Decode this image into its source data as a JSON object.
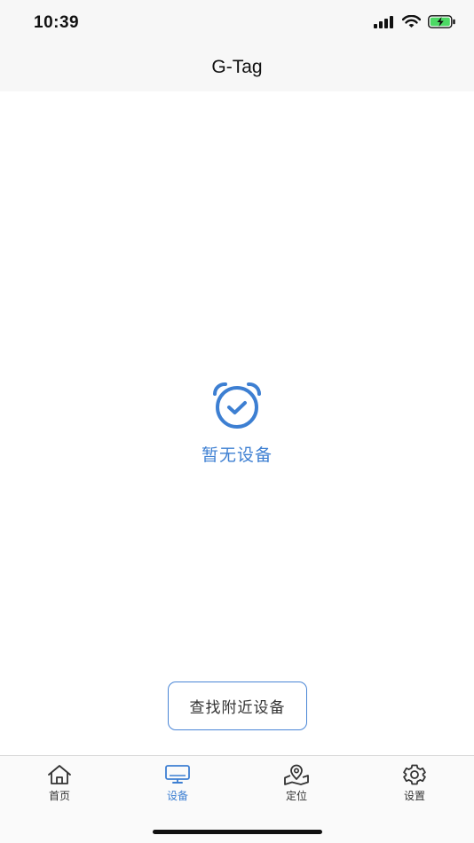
{
  "status_bar": {
    "time": "10:39"
  },
  "nav": {
    "title": "G-Tag"
  },
  "empty_state": {
    "icon": "alarm-check-icon",
    "message": "暂无设备"
  },
  "actions": {
    "find_nearby_label": "查找附近设备"
  },
  "tabbar": {
    "tabs": [
      {
        "label": "首页",
        "icon": "home-icon",
        "active": false
      },
      {
        "label": "设备",
        "icon": "monitor-icon",
        "active": true
      },
      {
        "label": "定位",
        "icon": "location-map-icon",
        "active": false
      },
      {
        "label": "设置",
        "icon": "gear-icon",
        "active": false
      }
    ]
  },
  "colors": {
    "accent": "#3d7fd2",
    "battery": "#4cd964",
    "header_bg": "#f7f7f7"
  }
}
